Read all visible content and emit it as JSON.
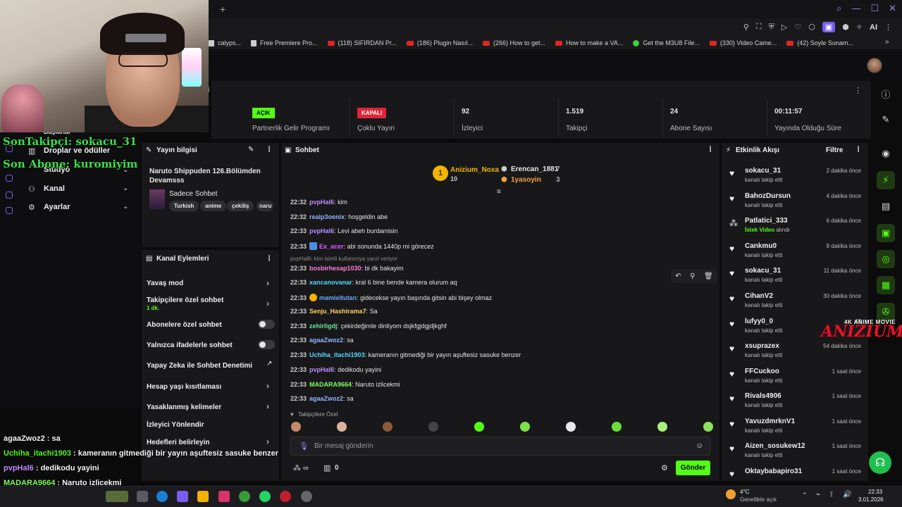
{
  "browser": {
    "bookmarks": [
      {
        "label": "calyps...",
        "kind": "doc"
      },
      {
        "label": "Free Premiere Pro...",
        "kind": "doc"
      },
      {
        "label": "(118) SIFIRDAN Pr...",
        "kind": "yt"
      },
      {
        "label": "(186) Plugin Nasıl...",
        "kind": "yt"
      },
      {
        "label": "(266) How to get...",
        "kind": "yt"
      },
      {
        "label": "How to make a VA...",
        "kind": "yt"
      },
      {
        "label": "Get the M3U8 File...",
        "kind": "gr"
      },
      {
        "label": "(330) Video Came...",
        "kind": "yt"
      },
      {
        "label": "(42) Soyle Sunam...",
        "kind": "yt"
      }
    ],
    "more": "»",
    "ai_label": "AI"
  },
  "stats": {
    "title": "ri",
    "partner": {
      "badge": "AÇIK",
      "label": "Partnerlik Gelir Programı"
    },
    "multistream": {
      "badge": "KAPALI",
      "label": "Çoklu Yayın"
    },
    "viewers": {
      "value": "92",
      "label": "İzleyici"
    },
    "followers": {
      "value": "1.519",
      "label": "Takipçi"
    },
    "subs": {
      "value": "24",
      "label": "Abone Sayısı"
    },
    "uptime": {
      "value": "00:11:57",
      "label": "Yayında Olduğu Süre"
    }
  },
  "leftnav": {
    "items": [
      {
        "label": "Başlarlar"
      },
      {
        "label": "Droplar ve ödüller"
      },
      {
        "label": "Stüdyo"
      },
      {
        "label": "Kanal"
      },
      {
        "label": "Ayarlar"
      }
    ]
  },
  "overlay": {
    "last_follower": "SonTakipçi: sokacu_31",
    "last_sub": "Son Abone: kuromiyim"
  },
  "stream_info": {
    "header": "Yayın bilgisi",
    "title": "Naruto Shippuden 126.Bölümden Devamsss",
    "category": "Sadece Sohbet",
    "tags": [
      "Turkish",
      "anime",
      "çekiliş",
      "naru"
    ]
  },
  "channel_actions": {
    "header": "Kanal Eylemleri",
    "items": [
      {
        "label": "Yavaş mod"
      },
      {
        "label": "Takipçilere özel sohbet",
        "sub": "1 dk."
      },
      {
        "label": "Abonelere özel sohbet"
      },
      {
        "label": "Yalnızca ifadelerle sohbet"
      },
      {
        "label": "Yapay Zeka ile Sohbet Denetimi"
      },
      {
        "label": "Hesap yaşı kısıtlaması"
      },
      {
        "label": "Yasaklanmış kelimeler"
      },
      {
        "label": "İzleyici Yönlendir"
      },
      {
        "label": "Hedefleri belirleyin"
      }
    ]
  },
  "chat": {
    "header": "Sohbet",
    "top_gifters": [
      {
        "rank": "1",
        "name": "Anizium_Noxa",
        "count": "10"
      },
      {
        "name": "Erencan_1881",
        "count": "7"
      },
      {
        "name": "1yasoyin",
        "count": "3"
      }
    ],
    "messages": [
      {
        "time": "22:32",
        "user": "pvpHal6",
        "text": "kim",
        "color": "#b98cff"
      },
      {
        "time": "22:32",
        "user": "realp3oenix",
        "text": "hoşgeldin abe",
        "color": "#8fb3ff"
      },
      {
        "time": "22:33",
        "user": "pvpHal6",
        "text": "Levi abeh burdamisin",
        "color": "#b98cff"
      },
      {
        "time": "22:33",
        "user": "Ex_acer",
        "text": "abi sonunda 1440p mi görecez",
        "color": "#e05cff"
      },
      {
        "time": "22:33",
        "user": "bosbirhesap1030",
        "text": "bi dk bakayim",
        "color": "#ff7ad9"
      },
      {
        "time": "22:33",
        "user": "xancanovanar",
        "text": "kral 6 bine bende kamera olurum aq",
        "color": "#53d6ff"
      },
      {
        "time": "22:33",
        "user": "mamieltutan",
        "text": "gidecekse yayın başında gitsin abi bişey olmaz",
        "color": "#6aa6ff"
      },
      {
        "time": "22:33",
        "user": "Senju_Hashirama7",
        "text": "Sa",
        "color": "#ffd166"
      },
      {
        "time": "22:33",
        "user": "zehirligdj",
        "text": "çekirdeğimle dinliyom dsjkfgjdgjdjkghf",
        "color": "#6ce0a0"
      },
      {
        "time": "22:33",
        "user": "agaaZwoz2",
        "text": "sa",
        "color": "#8fb3ff"
      },
      {
        "time": "22:33",
        "user": "Uchiha_itachi1903",
        "text": "kameranın gitmediği bir yayın aşuftesiz sasuke benzer",
        "color": "#53d6ff"
      },
      {
        "time": "22:33",
        "user": "pvpHal6",
        "text": "dedikodu yayini",
        "color": "#b98cff"
      },
      {
        "time": "22:33",
        "user": "MADARA9664",
        "text": "Naruto izlicekmi",
        "color": "#7dff5a"
      },
      {
        "time": "22:33",
        "user": "agaaZwoz2",
        "text": "sa",
        "color": "#8fb3ff"
      }
    ],
    "reply_hint": "pvpHal6: kim isimli kullanıcıya yanıt veriyor",
    "followers_only": "Takipçilere Özel",
    "input_placeholder": "Bir mesaj gönderin",
    "points": "0",
    "send_label": "Gönder"
  },
  "feed": {
    "header": "Etkinlik Akışı",
    "filter": "Filtre",
    "items": [
      {
        "name": "sokacu_31",
        "sub": "kanalı takip etti",
        "time": "2 dakika önce"
      },
      {
        "name": "BahozDursun",
        "sub": "kanalı takip etti",
        "time": "4 dakika önce"
      },
      {
        "name": "Patlatici_333",
        "sub_hl": "İstek Video",
        "sub": "alındı",
        "time": "6 dakika önce"
      },
      {
        "name": "Cankmu0",
        "sub": "kanalı takip etti",
        "time": "8 dakika önce"
      },
      {
        "name": "sokacu_31",
        "sub": "kanalı takip etti",
        "time": "11 dakika önce"
      },
      {
        "name": "CihanV2",
        "sub": "kanalı takip etti",
        "time": "30 dakika önce"
      },
      {
        "name": "lufyy0_0",
        "sub": "kanalı takip etti",
        "time": "43"
      },
      {
        "name": "xsuprazex",
        "sub": "kanalı takip etti",
        "time": "54 dakika önce"
      },
      {
        "name": "FFCuckoo",
        "sub": "kanalı takip etti",
        "time": "1 saat önce"
      },
      {
        "name": "Rivals4906",
        "sub": "kanalı takip etti",
        "time": "1 saat önce"
      },
      {
        "name": "YavuzdmrknV1",
        "sub": "kanalı takip etti",
        "time": "1 saat önce"
      },
      {
        "name": "Aizen_sosukew12",
        "sub": "kanalı takip etti",
        "time": "1 saat önce"
      },
      {
        "name": "Oktaybabapiro31",
        "sub": "",
        "time": "1 saat önce"
      }
    ]
  },
  "overlay_chat": [
    {
      "user": "agaaZwoz2",
      "text": " : sa",
      "color": "#f6f6f6"
    },
    {
      "user": "Uchiha_itachi1903",
      "text": " : kameranın gitmediği bir yayın aşuftesiz sasuke benzer",
      "color": "#53fc18"
    },
    {
      "user": "pvpHal6",
      "text": " : dedikodu yayini",
      "color": "#c08cff"
    },
    {
      "user": "MADARA9664",
      "text": " : Naruto izlicekmi",
      "color": "#7dff5a"
    },
    {
      "user": "agaaZwoz2",
      "text": " : sa",
      "color": "#f6f6f6"
    }
  ],
  "logo": {
    "top": "4K ANIME MOVIE",
    "main": "ANIZIUM"
  },
  "taskbar": {
    "weather_temp": "4°C",
    "weather_desc": "Genellikle açık",
    "time": "22:33",
    "date": "3.01.2026"
  }
}
